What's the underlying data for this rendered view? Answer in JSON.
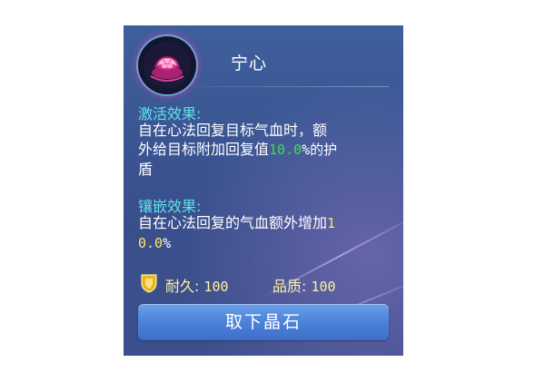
{
  "gem": {
    "name": "宁心",
    "icon": "lotus-gem-icon"
  },
  "activation": {
    "heading": "激活效果:",
    "line1": "自在心法回复目标气血时，额",
    "line2_pre": "外给目标附加回复值",
    "line2_value": "10.0",
    "line2_post": "%的护",
    "line3": "盾"
  },
  "inlay": {
    "heading": "镶嵌效果:",
    "line1_pre": "自在心法回复的气血额外增加",
    "line1_value": "1",
    "line2_value": "0.0",
    "line2_post": "%"
  },
  "stats": {
    "durability_label": "耐久:",
    "durability_value": "100",
    "quality_label": "品质:",
    "quality_value": "100",
    "icon": "shield-icon"
  },
  "actions": {
    "remove_label": "取下晶石"
  },
  "colors": {
    "panel": "#3a5592",
    "heading": "#5fe3ea",
    "value_green": "#3fdc4b",
    "value_yellow": "#ffe766",
    "button": "#4c82d9"
  }
}
